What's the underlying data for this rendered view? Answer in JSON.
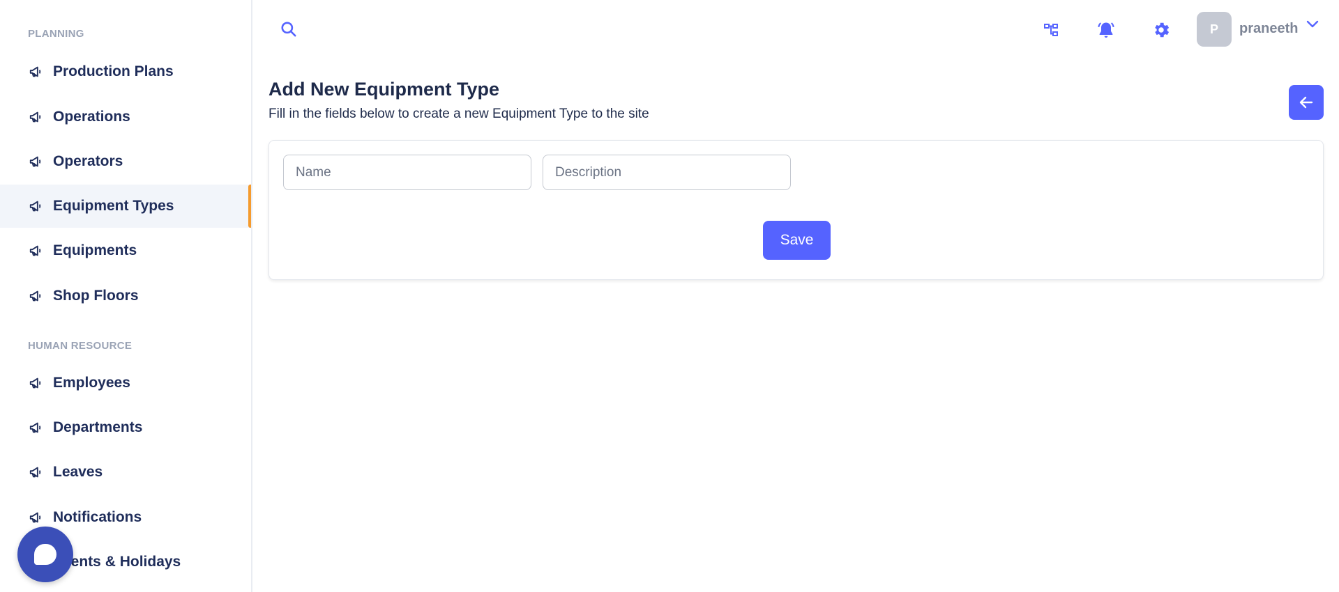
{
  "sidebar": {
    "sections": [
      {
        "title": "PLANNING",
        "items": [
          {
            "label": "Production Plans",
            "active": false
          },
          {
            "label": "Operations",
            "active": false
          },
          {
            "label": "Operators",
            "active": false
          },
          {
            "label": "Equipment Types",
            "active": true
          },
          {
            "label": "Equipments",
            "active": false
          },
          {
            "label": "Shop Floors",
            "active": false
          }
        ]
      },
      {
        "title": "HUMAN RESOURCE",
        "items": [
          {
            "label": "Employees",
            "active": false
          },
          {
            "label": "Departments",
            "active": false
          },
          {
            "label": "Leaves",
            "active": false
          },
          {
            "label": "Notifications",
            "active": false
          },
          {
            "label": "Events & Holidays",
            "active": false
          }
        ]
      }
    ],
    "item_icon": "megaphone-icon"
  },
  "topbar": {
    "icons": [
      "search-icon",
      "org-chart-icon",
      "bell-icon",
      "gear-icon",
      "chevron-down-icon"
    ],
    "user": {
      "initial": "P",
      "name": "praneeth"
    }
  },
  "main": {
    "title": "Add New Equipment Type",
    "subtitle": "Fill in the fields below to create a new Equipment Type to the site",
    "form": {
      "name": {
        "value": "",
        "placeholder": "Name"
      },
      "description": {
        "value": "",
        "placeholder": "Description"
      },
      "save_label": "Save"
    }
  },
  "colors": {
    "accent": "#5563ff",
    "active_indicator": "#f59b2e",
    "nav_text": "#1f2d5a",
    "section_title": "#9aa3b5",
    "chat_bubble": "#3b4fb8"
  }
}
